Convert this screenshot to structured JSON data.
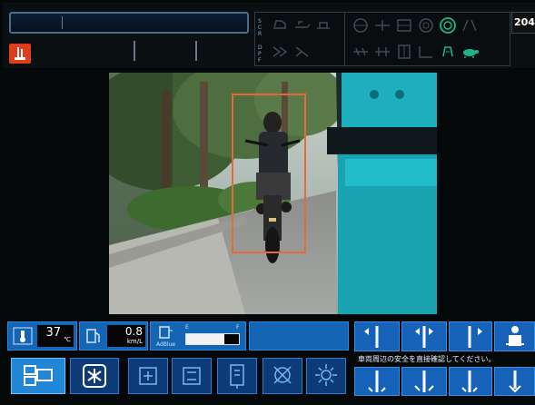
{
  "status": {
    "code": "204"
  },
  "mode_labels": {
    "left_letters": "S·C·R",
    "second_letters": "D·P·F"
  },
  "camera": {
    "detection": "motorcycle-rider"
  },
  "readouts": {
    "temperature": {
      "value": "37",
      "unit": "℃"
    },
    "fuel_rate": {
      "value": "0.8",
      "unit": "km/L"
    },
    "adblue": {
      "label": "AdBlue",
      "low": "E",
      "high": "F",
      "level": 0.72
    }
  },
  "notice": {
    "text": "車両周辺の安全を直接確認してください。"
  },
  "colors": {
    "accent": "#1565b5",
    "warning": "#e03d1c",
    "detection_box": "#e8683a",
    "bus": "#19a3b0"
  }
}
